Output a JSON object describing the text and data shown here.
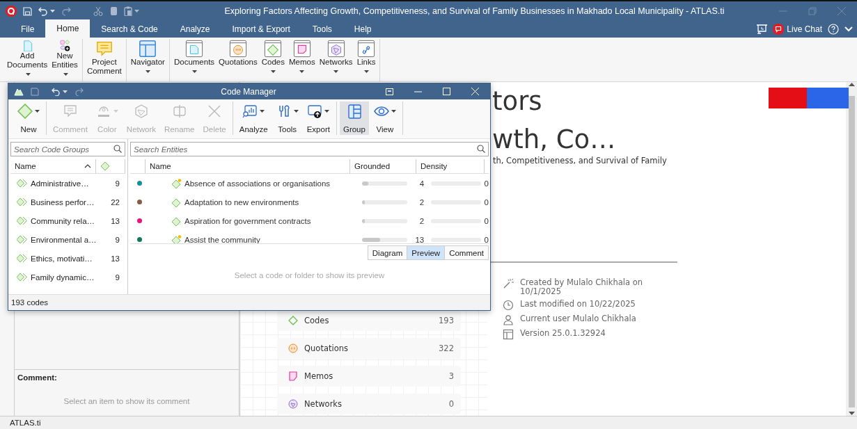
{
  "window": {
    "title": "Exploring Factors Affecting Growth, Competitiveness, and Survival of Family Businesses in Makhado Local Municipality - ATLAS.ti"
  },
  "menu_tabs": [
    {
      "label": "File",
      "selected": false
    },
    {
      "label": "Home",
      "selected": true
    },
    {
      "label": "Search & Code",
      "selected": false
    },
    {
      "label": "Analyze",
      "selected": false
    },
    {
      "label": "Import & Export",
      "selected": false
    },
    {
      "label": "Tools",
      "selected": false
    },
    {
      "label": "Help",
      "selected": false
    }
  ],
  "live_chat": "Live Chat",
  "ribbon": [
    [
      {
        "label": "Add Documents",
        "kind": "add-document",
        "menu": true
      },
      {
        "label": "New Entities",
        "kind": "entities",
        "menu": true
      }
    ],
    [
      {
        "label": "Project Comment",
        "kind": "comment",
        "menu": false
      }
    ],
    [
      {
        "label": "Navigator",
        "kind": "navigator",
        "menu": true
      }
    ],
    [
      {
        "label": "Documents",
        "kind": "documents",
        "menu": true
      },
      {
        "label": "Quotations",
        "kind": "quotations",
        "menu": false
      },
      {
        "label": "Codes",
        "kind": "codes",
        "menu": true
      },
      {
        "label": "Memos",
        "kind": "memos",
        "menu": true
      },
      {
        "label": "Networks",
        "kind": "networks",
        "menu": true
      },
      {
        "label": "Links",
        "kind": "links",
        "menu": true
      }
    ]
  ],
  "code_manager": {
    "title": "Code Manager",
    "toolbar": [
      [
        {
          "label": "New",
          "kind": "new",
          "menu": true,
          "disabled": false,
          "selected": false
        }
      ],
      [
        {
          "label": "Comment",
          "kind": "comment",
          "disabled": true,
          "selected": false
        },
        {
          "label": "Color",
          "kind": "color",
          "menu": true,
          "disabled": true,
          "selected": false
        },
        {
          "label": "Network",
          "kind": "network",
          "disabled": true,
          "selected": false
        },
        {
          "label": "Rename",
          "kind": "rename",
          "disabled": true,
          "selected": false
        },
        {
          "label": "Delete",
          "kind": "delete",
          "disabled": true,
          "selected": false
        }
      ],
      [
        {
          "label": "Analyze",
          "kind": "analyze",
          "menu": true,
          "disabled": false,
          "selected": false
        },
        {
          "label": "Tools",
          "kind": "tools",
          "menu": true,
          "disabled": false,
          "selected": false
        },
        {
          "label": "Export",
          "kind": "export",
          "menu": true,
          "disabled": false,
          "selected": false
        }
      ],
      [
        {
          "label": "Group",
          "kind": "group",
          "disabled": false,
          "selected": true
        },
        {
          "label": "View",
          "kind": "view",
          "menu": true,
          "disabled": false,
          "selected": false
        }
      ]
    ],
    "group_search": {
      "placeholder": "Search Code Groups"
    },
    "group_columns": [
      "Name"
    ],
    "groups": [
      {
        "name": "Administrative…",
        "count": "9"
      },
      {
        "name": "Business perfor…",
        "count": "22"
      },
      {
        "name": "Community rela…",
        "count": "13"
      },
      {
        "name": "Environmental a…",
        "count": "9"
      },
      {
        "name": "Ethics, motivati…",
        "count": "13"
      },
      {
        "name": "Family dynamic…",
        "count": "9"
      }
    ],
    "entity_search": {
      "placeholder": "Search Entities"
    },
    "entity_columns": [
      "Name",
      "Grounded",
      "Density"
    ],
    "entities": [
      {
        "name": "Absence of associations or organisations",
        "color": "#16909a",
        "commented": true,
        "grounded": {
          "value": "4",
          "level": 0.13
        },
        "density": "0"
      },
      {
        "name": "Adaptation to new environments",
        "color": "#8a5a44",
        "commented": false,
        "grounded": {
          "value": "2",
          "level": 0.05
        },
        "density": "0"
      },
      {
        "name": "Aspiration for government contracts",
        "color": "#e8147e",
        "commented": false,
        "grounded": {
          "value": "2",
          "level": 0.05
        },
        "density": "0"
      },
      {
        "name": "Assist the community",
        "color": "#127a58",
        "commented": true,
        "grounded": {
          "value": "13",
          "level": 0.4
        },
        "density": "0"
      }
    ],
    "preview_tabs": [
      {
        "label": "Diagram",
        "selected": false
      },
      {
        "label": "Preview",
        "selected": true
      },
      {
        "label": "Comment",
        "selected": false
      }
    ],
    "preview_message": "Select a code or folder to show its preview",
    "status": "193 codes"
  },
  "left_panel": {
    "comment_label": "Comment:",
    "comment_placeholder": "Select an item to show its comment"
  },
  "project": {
    "title_lines": [
      "tors",
      "wth, Co…"
    ],
    "subtitle": "th, Competitiveness, and Survival of Family",
    "counts": [
      {
        "kind": "codes",
        "label": "Codes",
        "count": "193"
      },
      {
        "kind": "quotations",
        "label": "Quotations",
        "count": "322"
      },
      {
        "kind": "memos",
        "label": "Memos",
        "count": "3"
      },
      {
        "kind": "networks",
        "label": "Networks",
        "count": "0"
      }
    ],
    "info": [
      {
        "kind": "created",
        "text": "Created by Mulalo Chikhala on 10/1/2025"
      },
      {
        "kind": "modified",
        "text": "Last modified on 10/22/2025"
      },
      {
        "kind": "user",
        "text": "Current user Mulalo Chikhala"
      },
      {
        "kind": "version",
        "text": "Version 25.0.1.32924"
      }
    ]
  },
  "status_bar": "ATLAS.ti"
}
